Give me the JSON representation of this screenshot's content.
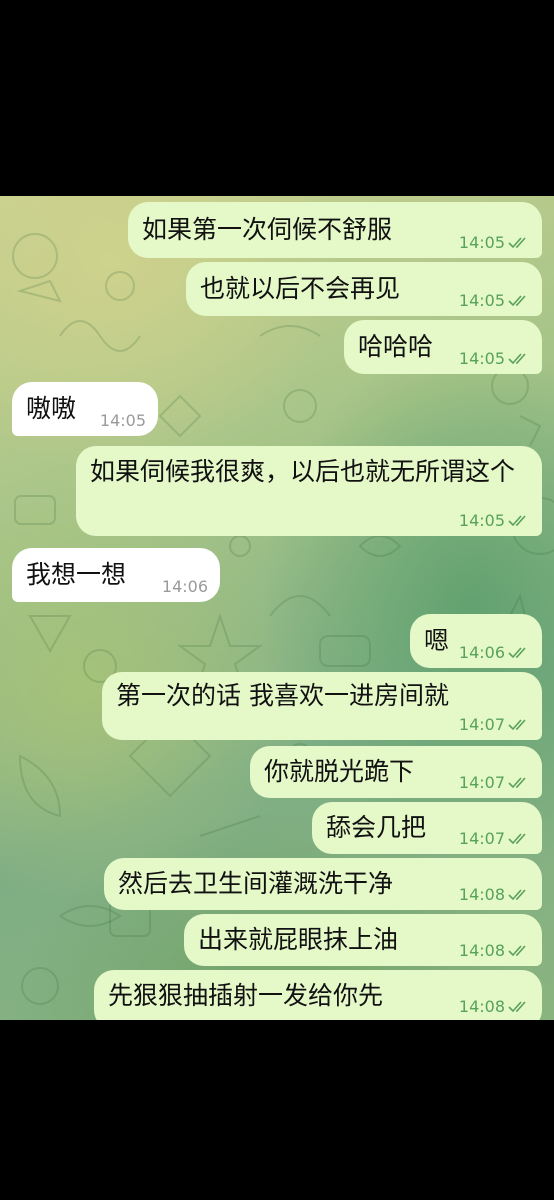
{
  "messages": [
    {
      "dir": "out",
      "text": "如果第一次伺候不舒服",
      "time": "14:05",
      "status": "read"
    },
    {
      "dir": "out",
      "text": "也就以后不会再见",
      "time": "14:05",
      "status": "read"
    },
    {
      "dir": "out",
      "text": "哈哈哈",
      "time": "14:05",
      "status": "read"
    },
    {
      "dir": "in",
      "text": "嗷嗷",
      "time": "14:05"
    },
    {
      "dir": "out",
      "text": "如果伺候我很爽，以后也就无所谓这个",
      "time": "14:05",
      "status": "read"
    },
    {
      "dir": "in",
      "text": "我想一想",
      "time": "14:06"
    },
    {
      "dir": "out",
      "text": "嗯",
      "time": "14:06",
      "status": "read"
    },
    {
      "dir": "out",
      "text": "第一次的话 我喜欢一进房间就",
      "time": "14:07",
      "status": "read"
    },
    {
      "dir": "out",
      "text": "你就脱光跪下",
      "time": "14:07",
      "status": "read"
    },
    {
      "dir": "out",
      "text": "舔会几把",
      "time": "14:07",
      "status": "read"
    },
    {
      "dir": "out",
      "text": "然后去卫生间灌溉洗干净",
      "time": "14:08",
      "status": "read"
    },
    {
      "dir": "out",
      "text": "出来就屁眼抹上油",
      "time": "14:08",
      "status": "read"
    },
    {
      "dir": "out",
      "text": "先狠狠抽插射一发给你先",
      "time": "14:08",
      "status": "read"
    }
  ],
  "colors": {
    "outgoing_bubble": "#e5f8c8",
    "incoming_bubble": "#ffffff",
    "outgoing_meta": "#58a25a",
    "incoming_meta": "#9a9a9a"
  },
  "icons": {
    "read_receipt": "double-check-icon",
    "background": "chat-wallpaper-doodles"
  }
}
